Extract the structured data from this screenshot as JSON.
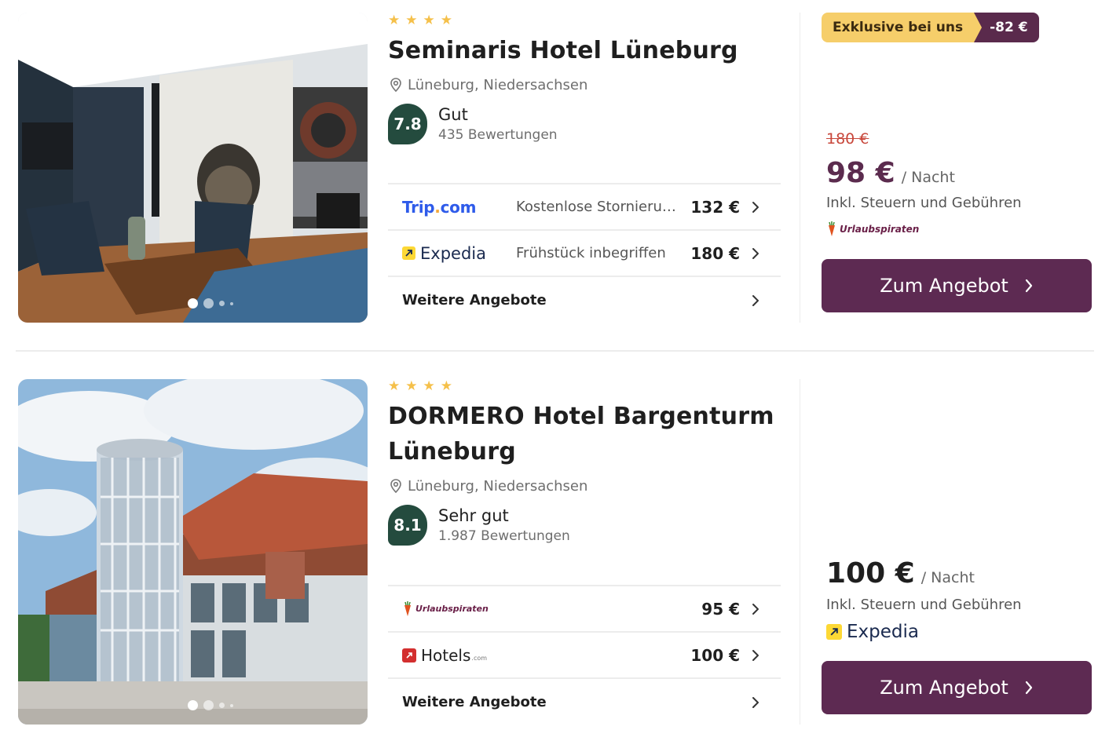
{
  "colors": {
    "accent": "#5d2a52",
    "score_bg": "#244b3e",
    "star": "#f5c04a",
    "old_price": "#c8473b",
    "badge_yellow": "#f6ce6a",
    "badge_purple": "#5a2a4c",
    "price_purple": "#5b2b4e"
  },
  "hotels": [
    {
      "stars": 4,
      "name": "Seminaris Hotel Lüneburg",
      "location": "Lüneburg, Niedersachsen",
      "score": "7.8",
      "rating_label": "Gut",
      "reviews": "435 Bewertungen",
      "offers": [
        {
          "provider": "Trip.com",
          "provider_icon": "tripcom-logo",
          "note": "Kostenlose Stornierung",
          "price": "132 €"
        },
        {
          "provider": "Expedia",
          "provider_icon": "expedia-logo",
          "note": "Frühstück inbegriffen",
          "price": "180 €"
        }
      ],
      "more_offers": "Weitere Angebote",
      "badge_label": "Exklusive bei uns",
      "badge_discount": "-82 €",
      "old_price": "180 €",
      "price": "98 €",
      "per_night": "/ Nacht",
      "tax_note": "Inkl. Steuern und Gebühren",
      "price_provider": "Urlaubspiraten",
      "cta": "Zum Angebot",
      "photo_dots": 4
    },
    {
      "stars": 4,
      "name": "DORMERO Hotel Bargenturm Lüneburg",
      "location": "Lüneburg, Niedersachsen",
      "score": "8.1",
      "rating_label": "Sehr gut",
      "reviews": "1.987 Bewertungen",
      "offers": [
        {
          "provider": "Urlaubspiraten",
          "provider_icon": "urlaubspiraten-logo",
          "note": "",
          "price": "95 €"
        },
        {
          "provider": "Hotels",
          "provider_icon": "hotels-com-logo",
          "provider_suffix": ".com",
          "note": "",
          "price": "100 €"
        }
      ],
      "more_offers": "Weitere Angebote",
      "price": "100 €",
      "per_night": "/ Nacht",
      "tax_note": "Inkl. Steuern und Gebühren",
      "price_provider": "Expedia",
      "cta": "Zum Angebot",
      "photo_dots": 4
    }
  ]
}
